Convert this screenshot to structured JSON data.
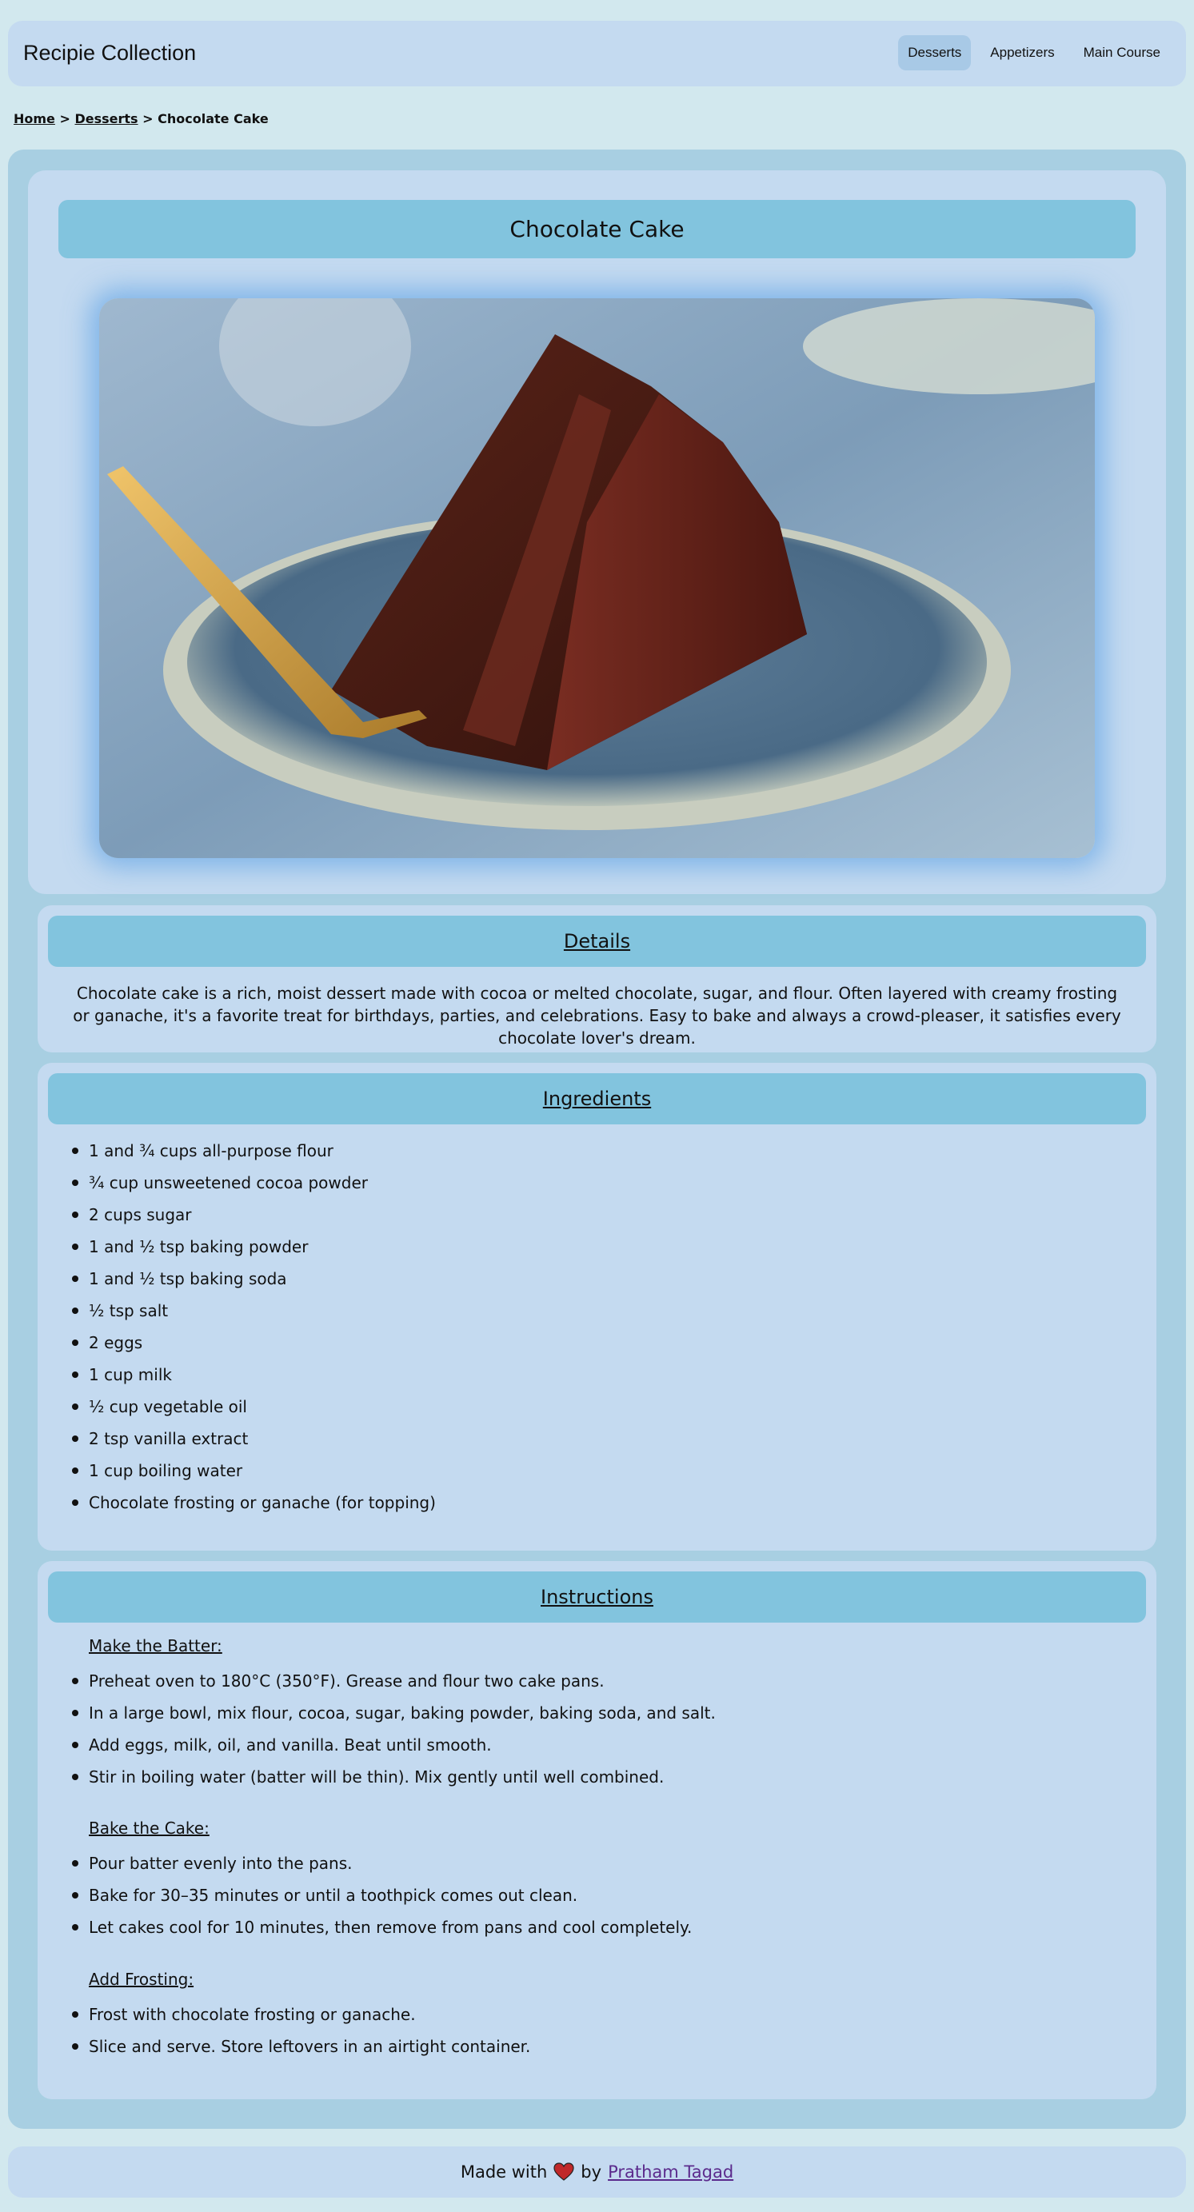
{
  "header": {
    "site_title": "Recipie Collection",
    "nav": [
      {
        "label": "Desserts",
        "active": true
      },
      {
        "label": "Appetizers",
        "active": false
      },
      {
        "label": "Main Course",
        "active": false
      }
    ]
  },
  "breadcrumb": {
    "home": "Home",
    "sep1": ">",
    "category": "Desserts",
    "sep2": ">",
    "current": "Chocolate Cake"
  },
  "recipe": {
    "title": "Chocolate Cake",
    "image_icon": "chocolate-cake-photo"
  },
  "details": {
    "heading": "Details",
    "text": "Chocolate cake is a rich, moist dessert made with cocoa or melted chocolate, sugar, and flour. Often layered with creamy frosting or ganache, it's a favorite treat for birthdays, parties, and celebrations. Easy to bake and always a crowd-pleaser, it satisfies every chocolate lover's dream."
  },
  "ingredients": {
    "heading": "Ingredients",
    "items": [
      "1 and ¾ cups all-purpose flour",
      "¾ cup unsweetened cocoa powder",
      "2 cups sugar",
      "1 and ½ tsp baking powder",
      "1 and ½ tsp baking soda",
      "½ tsp salt",
      "2 eggs",
      "1 cup milk",
      "½ cup vegetable oil",
      "2 tsp vanilla extract",
      "1 cup boiling water",
      "Chocolate frosting or ganache (for topping)"
    ]
  },
  "instructions": {
    "heading": "Instructions",
    "groups": [
      {
        "title": "Make the Batter:",
        "steps": [
          "Preheat oven to 180°C (350°F). Grease and flour two cake pans.",
          "In a large bowl, mix flour, cocoa, sugar, baking powder, baking soda, and salt.",
          "Add eggs, milk, oil, and vanilla. Beat until smooth.",
          "Stir in boiling water (batter will be thin). Mix gently until well combined."
        ]
      },
      {
        "title": "Bake the Cake:",
        "steps": [
          "Pour batter evenly into the pans.",
          "Bake for 30–35 minutes or until a toothpick comes out clean.",
          "Let cakes cool for 10 minutes, then remove from pans and cool completely."
        ]
      },
      {
        "title": "Add Frosting:",
        "steps": [
          "Frost with chocolate frosting or ganache.",
          "Slice and serve. Store leftovers in an airtight container."
        ]
      }
    ]
  },
  "footer": {
    "made_with": "Made with",
    "heart_icon": "heart-icon",
    "by": "by",
    "author": "Pratham Tagad"
  }
}
